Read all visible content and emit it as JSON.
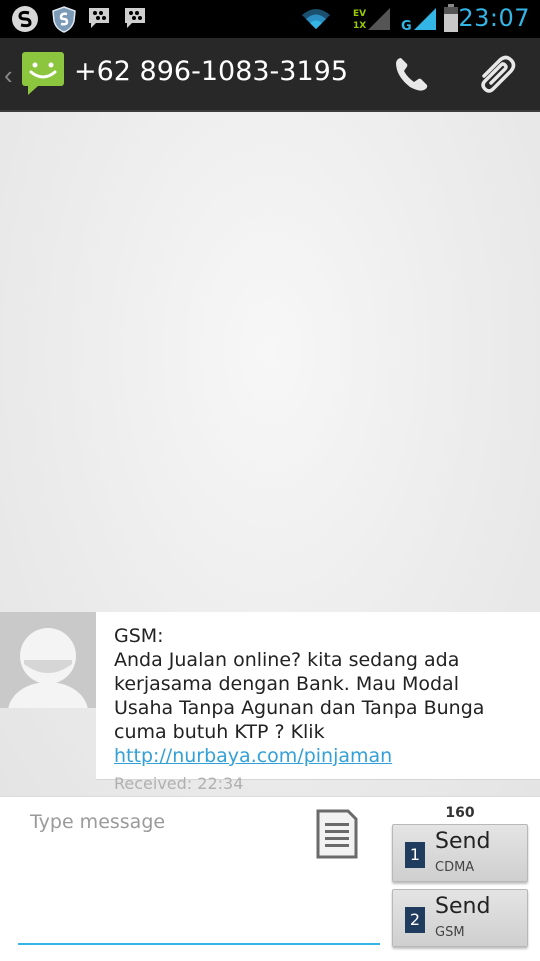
{
  "status_bar": {
    "time": "23:07",
    "network_labels": {
      "line1": "EV",
      "line2": "1X",
      "g": "G"
    },
    "icons": [
      "app-s-icon",
      "shield-icon",
      "bbm-icon",
      "bbm-icon",
      "wifi-icon",
      "signal-icon",
      "signal-icon",
      "battery-icon"
    ],
    "accent_color": "#33b5e5"
  },
  "action_bar": {
    "title": "+62 896-1083-3195",
    "icons": [
      "back-chevron-icon",
      "messaging-app-icon",
      "call-icon",
      "attach-icon"
    ]
  },
  "conversation": {
    "messages": [
      {
        "sender_label": "GSM:",
        "body": "Anda Jualan online? kita sedang ada kerjasama dengan Bank. Mau Modal Usaha Tanpa Agunan dan Tanpa Bunga cuma butuh KTP ? Klik ",
        "link": "http://nurbaya.com/pinjaman",
        "timestamp": "Received: 22:34"
      }
    ]
  },
  "compose": {
    "placeholder": "Type message",
    "value": "",
    "char_count": "160",
    "send_buttons": [
      {
        "sim": "1",
        "label": "Send",
        "network": "CDMA"
      },
      {
        "sim": "2",
        "label": "Send",
        "network": "GSM"
      }
    ]
  }
}
